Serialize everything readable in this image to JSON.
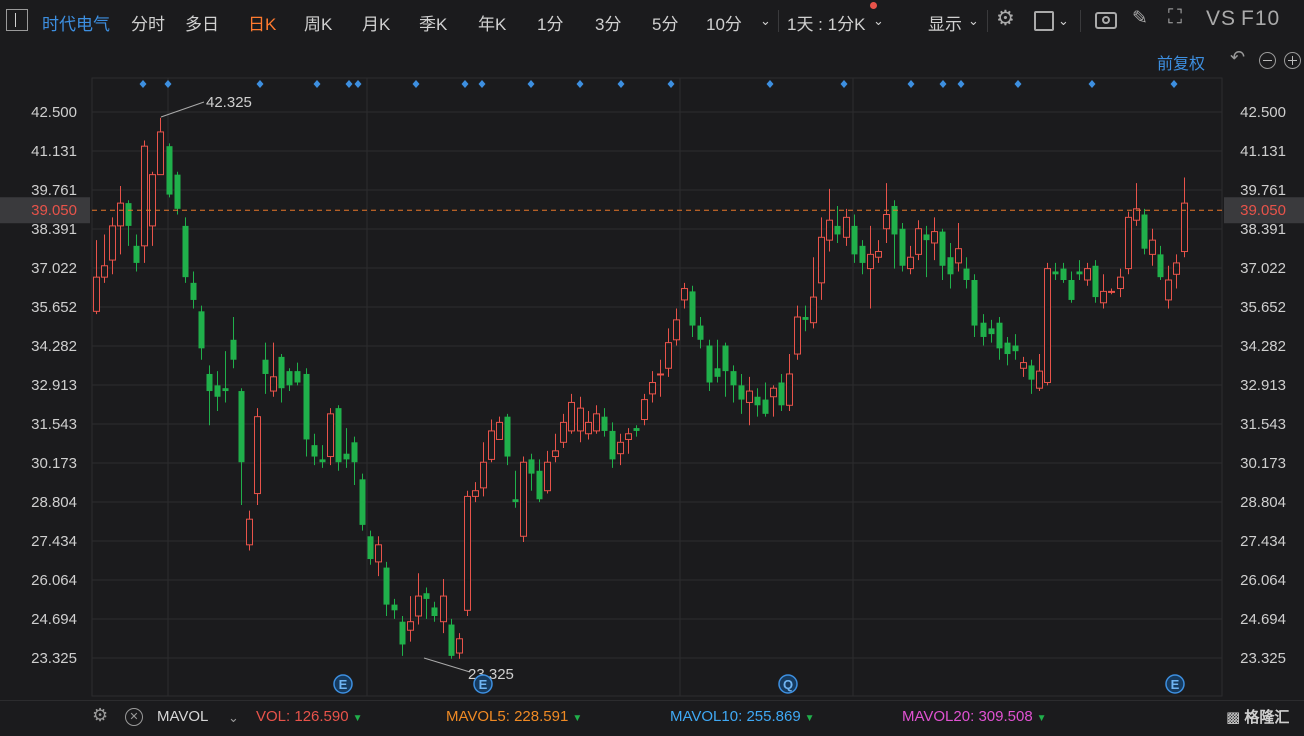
{
  "toolbar": {
    "stock_name": "时代电气",
    "periods": [
      "分时",
      "多日",
      "日K",
      "周K",
      "月K",
      "季K",
      "年K",
      "1分",
      "3分",
      "5分",
      "10分"
    ],
    "active_period": "日K",
    "one_day_label": "1天 : 1分K",
    "display_label": "显示",
    "vs_label": "VS",
    "f10_label": "F10"
  },
  "subbar": {
    "adjust_label": "前复权"
  },
  "colors": {
    "up": "#e8534a",
    "down": "#20b04b",
    "bg": "#1b1b1d",
    "grid": "#2c2c2e",
    "price_line": "#e8762a",
    "marker": "#3d8fe0"
  },
  "chart_data": {
    "type": "candlestick",
    "yticks": [
      "42.500",
      "41.131",
      "39.761",
      "38.391",
      "37.022",
      "35.652",
      "34.282",
      "32.913",
      "31.543",
      "30.173",
      "28.804",
      "27.434",
      "26.064",
      "24.694",
      "23.325"
    ],
    "ylim": [
      23.325,
      42.5
    ],
    "current_price": "39.050",
    "high_label": "42.325",
    "low_label": "23.325",
    "event_markers": [
      "E",
      "E",
      "Q",
      "E"
    ],
    "candles": [
      [
        35.5,
        36.7,
        35.4,
        38.0
      ],
      [
        36.7,
        37.1,
        36.5,
        38.2
      ],
      [
        37.3,
        38.5,
        36.8,
        38.8
      ],
      [
        38.5,
        39.3,
        37.5,
        39.9
      ],
      [
        39.3,
        38.5,
        37.8,
        39.4
      ],
      [
        37.8,
        37.2,
        36.9,
        38.2
      ],
      [
        37.8,
        41.3,
        37.2,
        41.5
      ],
      [
        38.5,
        40.3,
        37.8,
        40.4
      ],
      [
        40.3,
        41.8,
        40.3,
        42.3
      ],
      [
        41.3,
        39.6,
        39.5,
        41.4
      ],
      [
        40.3,
        39.1,
        38.9,
        40.4
      ],
      [
        38.5,
        36.7,
        36.5,
        38.8
      ],
      [
        36.5,
        35.9,
        35.6,
        36.9
      ],
      [
        35.5,
        34.2,
        33.8,
        35.7
      ],
      [
        33.3,
        32.7,
        31.5,
        33.6
      ],
      [
        32.9,
        32.5,
        32.0,
        33.4
      ],
      [
        32.8,
        32.7,
        32.3,
        34.1
      ],
      [
        34.5,
        33.8,
        33.5,
        35.3
      ],
      [
        32.7,
        30.2,
        28.7,
        32.8
      ],
      [
        27.3,
        28.2,
        27.1,
        28.5
      ],
      [
        29.1,
        31.8,
        28.7,
        32.1
      ],
      [
        33.8,
        33.3,
        32.6,
        34.4
      ],
      [
        32.7,
        33.2,
        32.5,
        34.4
      ],
      [
        33.9,
        32.8,
        32.3,
        34.0
      ],
      [
        33.4,
        32.9,
        32.7,
        33.5
      ],
      [
        33.4,
        33.0,
        32.9,
        33.7
      ],
      [
        33.3,
        31.0,
        30.4,
        33.5
      ],
      [
        30.8,
        30.4,
        30.1,
        31.2
      ],
      [
        30.3,
        30.2,
        30.0,
        30.8
      ],
      [
        30.4,
        31.9,
        30.1,
        32.1
      ],
      [
        32.1,
        30.2,
        29.9,
        32.2
      ],
      [
        30.5,
        30.3,
        30.0,
        31.4
      ],
      [
        30.9,
        30.2,
        29.4,
        31.1
      ],
      [
        29.6,
        28.0,
        27.8,
        29.8
      ],
      [
        27.6,
        26.8,
        26.6,
        27.8
      ],
      [
        26.7,
        27.3,
        26.2,
        27.6
      ],
      [
        26.5,
        25.2,
        24.8,
        26.7
      ],
      [
        25.2,
        25.0,
        24.7,
        25.4
      ],
      [
        24.6,
        23.8,
        23.4,
        24.8
      ],
      [
        24.3,
        24.6,
        23.9,
        25.5
      ],
      [
        24.8,
        25.5,
        24.5,
        26.3
      ],
      [
        25.6,
        25.4,
        24.7,
        25.8
      ],
      [
        25.1,
        24.8,
        24.6,
        25.3
      ],
      [
        24.6,
        25.5,
        24.2,
        26.1
      ],
      [
        24.5,
        23.4,
        23.3,
        24.7
      ],
      [
        23.5,
        24.0,
        23.3,
        24.2
      ],
      [
        25.0,
        29.0,
        24.8,
        29.2
      ],
      [
        29.0,
        29.2,
        28.8,
        29.5
      ],
      [
        29.3,
        30.2,
        29.0,
        30.9
      ],
      [
        30.3,
        31.3,
        30.2,
        31.7
      ],
      [
        31.0,
        31.6,
        31.0,
        31.8
      ],
      [
        31.8,
        30.4,
        30.1,
        31.9
      ],
      [
        28.9,
        28.8,
        28.6,
        29.9
      ],
      [
        27.6,
        30.2,
        27.4,
        30.4
      ],
      [
        30.3,
        29.8,
        29.2,
        30.5
      ],
      [
        29.9,
        28.9,
        28.8,
        30.3
      ],
      [
        29.2,
        30.2,
        29.1,
        30.6
      ],
      [
        30.4,
        30.6,
        30.2,
        31.2
      ],
      [
        30.9,
        31.6,
        30.7,
        31.9
      ],
      [
        31.3,
        32.3,
        31.2,
        32.6
      ],
      [
        31.3,
        32.1,
        30.9,
        32.5
      ],
      [
        31.2,
        31.6,
        31.0,
        32.0
      ],
      [
        31.3,
        31.9,
        31.2,
        32.2
      ],
      [
        31.8,
        31.3,
        31.1,
        32.1
      ],
      [
        31.3,
        30.3,
        30.0,
        31.6
      ],
      [
        30.5,
        30.9,
        30.1,
        31.2
      ],
      [
        31.0,
        31.2,
        30.5,
        31.4
      ],
      [
        31.4,
        31.3,
        31.1,
        31.5
      ],
      [
        31.7,
        32.4,
        31.5,
        32.6
      ],
      [
        32.6,
        33.0,
        32.3,
        33.4
      ],
      [
        33.3,
        33.3,
        32.5,
        33.8
      ],
      [
        33.5,
        34.4,
        33.2,
        34.9
      ],
      [
        34.5,
        35.2,
        34.3,
        35.6
      ],
      [
        35.9,
        36.3,
        35.6,
        36.5
      ],
      [
        36.2,
        35.0,
        34.6,
        36.4
      ],
      [
        35.0,
        34.5,
        34.2,
        35.3
      ],
      [
        34.3,
        33.0,
        32.7,
        34.5
      ],
      [
        33.5,
        33.2,
        33.0,
        34.5
      ],
      [
        34.3,
        33.4,
        32.5,
        34.4
      ],
      [
        33.4,
        32.9,
        32.3,
        33.6
      ],
      [
        32.9,
        32.4,
        31.9,
        33.3
      ],
      [
        32.3,
        32.7,
        31.5,
        33.2
      ],
      [
        32.5,
        32.2,
        31.8,
        32.8
      ],
      [
        32.4,
        31.9,
        31.8,
        33.0
      ],
      [
        32.5,
        32.8,
        31.8,
        32.9
      ],
      [
        33.0,
        32.2,
        32.0,
        33.3
      ],
      [
        32.2,
        33.3,
        32.0,
        34.0
      ],
      [
        34.0,
        35.3,
        33.8,
        35.7
      ],
      [
        35.3,
        35.2,
        34.8,
        35.7
      ],
      [
        35.1,
        36.0,
        34.9,
        37.4
      ],
      [
        36.5,
        38.1,
        35.9,
        38.8
      ],
      [
        38.0,
        38.7,
        37.6,
        39.8
      ],
      [
        38.5,
        38.2,
        37.9,
        39.2
      ],
      [
        38.1,
        38.8,
        37.8,
        39.1
      ],
      [
        38.5,
        37.5,
        37.2,
        38.9
      ],
      [
        37.8,
        37.2,
        36.8,
        38.0
      ],
      [
        37.0,
        37.5,
        35.6,
        38.5
      ],
      [
        37.4,
        37.6,
        37.2,
        38.0
      ],
      [
        38.4,
        38.9,
        37.9,
        40.0
      ],
      [
        39.2,
        38.2,
        37.0,
        39.4
      ],
      [
        38.4,
        37.1,
        36.9,
        38.6
      ],
      [
        37.0,
        37.4,
        36.8,
        37.8
      ],
      [
        37.5,
        38.4,
        37.3,
        38.7
      ],
      [
        38.2,
        38.0,
        36.7,
        38.5
      ],
      [
        37.9,
        38.3,
        37.3,
        38.8
      ],
      [
        38.3,
        37.1,
        36.6,
        38.4
      ],
      [
        37.4,
        36.8,
        36.3,
        37.9
      ],
      [
        37.2,
        37.7,
        36.9,
        38.6
      ],
      [
        37.0,
        36.6,
        36.3,
        37.4
      ],
      [
        36.6,
        35.0,
        34.6,
        36.8
      ],
      [
        35.1,
        34.6,
        34.3,
        35.4
      ],
      [
        34.9,
        34.7,
        34.4,
        35.2
      ],
      [
        35.1,
        34.2,
        33.8,
        35.3
      ],
      [
        34.4,
        34.0,
        33.6,
        34.6
      ],
      [
        34.3,
        34.1,
        33.8,
        34.7
      ],
      [
        33.5,
        33.7,
        33.2,
        33.9
      ],
      [
        33.6,
        33.1,
        32.6,
        33.8
      ],
      [
        32.8,
        33.4,
        32.7,
        34.0
      ],
      [
        33.0,
        37.0,
        32.9,
        37.2
      ],
      [
        36.9,
        36.8,
        36.6,
        37.2
      ],
      [
        37.0,
        36.6,
        36.5,
        37.2
      ],
      [
        36.6,
        35.9,
        35.8,
        36.9
      ],
      [
        36.9,
        36.8,
        36.6,
        37.3
      ],
      [
        36.6,
        37.0,
        36.4,
        37.2
      ],
      [
        37.1,
        36.0,
        35.8,
        37.3
      ],
      [
        35.8,
        36.2,
        35.6,
        36.8
      ],
      [
        36.2,
        36.2,
        36.1,
        36.3
      ],
      [
        36.3,
        36.7,
        36.0,
        37.0
      ],
      [
        37.0,
        38.8,
        36.8,
        39.0
      ],
      [
        38.7,
        39.1,
        38.5,
        40.0
      ],
      [
        38.9,
        37.7,
        37.5,
        39.1
      ],
      [
        37.5,
        38.0,
        37.1,
        38.4
      ],
      [
        37.5,
        36.7,
        36.6,
        37.8
      ],
      [
        35.9,
        36.6,
        35.6,
        37.1
      ],
      [
        36.8,
        37.2,
        36.3,
        37.5
      ],
      [
        37.6,
        39.3,
        37.4,
        40.2
      ]
    ]
  },
  "bottom": {
    "indicator": "MAVOL",
    "vol_label": "VOL:",
    "vol_value": "126.590",
    "ma5_label": "MAVOL5:",
    "ma5_value": "228.591",
    "ma10_label": "MAVOL10:",
    "ma10_value": "255.869",
    "ma20_label": "MAVOL20:",
    "ma20_value": "309.508",
    "logo_text": "格隆汇"
  }
}
